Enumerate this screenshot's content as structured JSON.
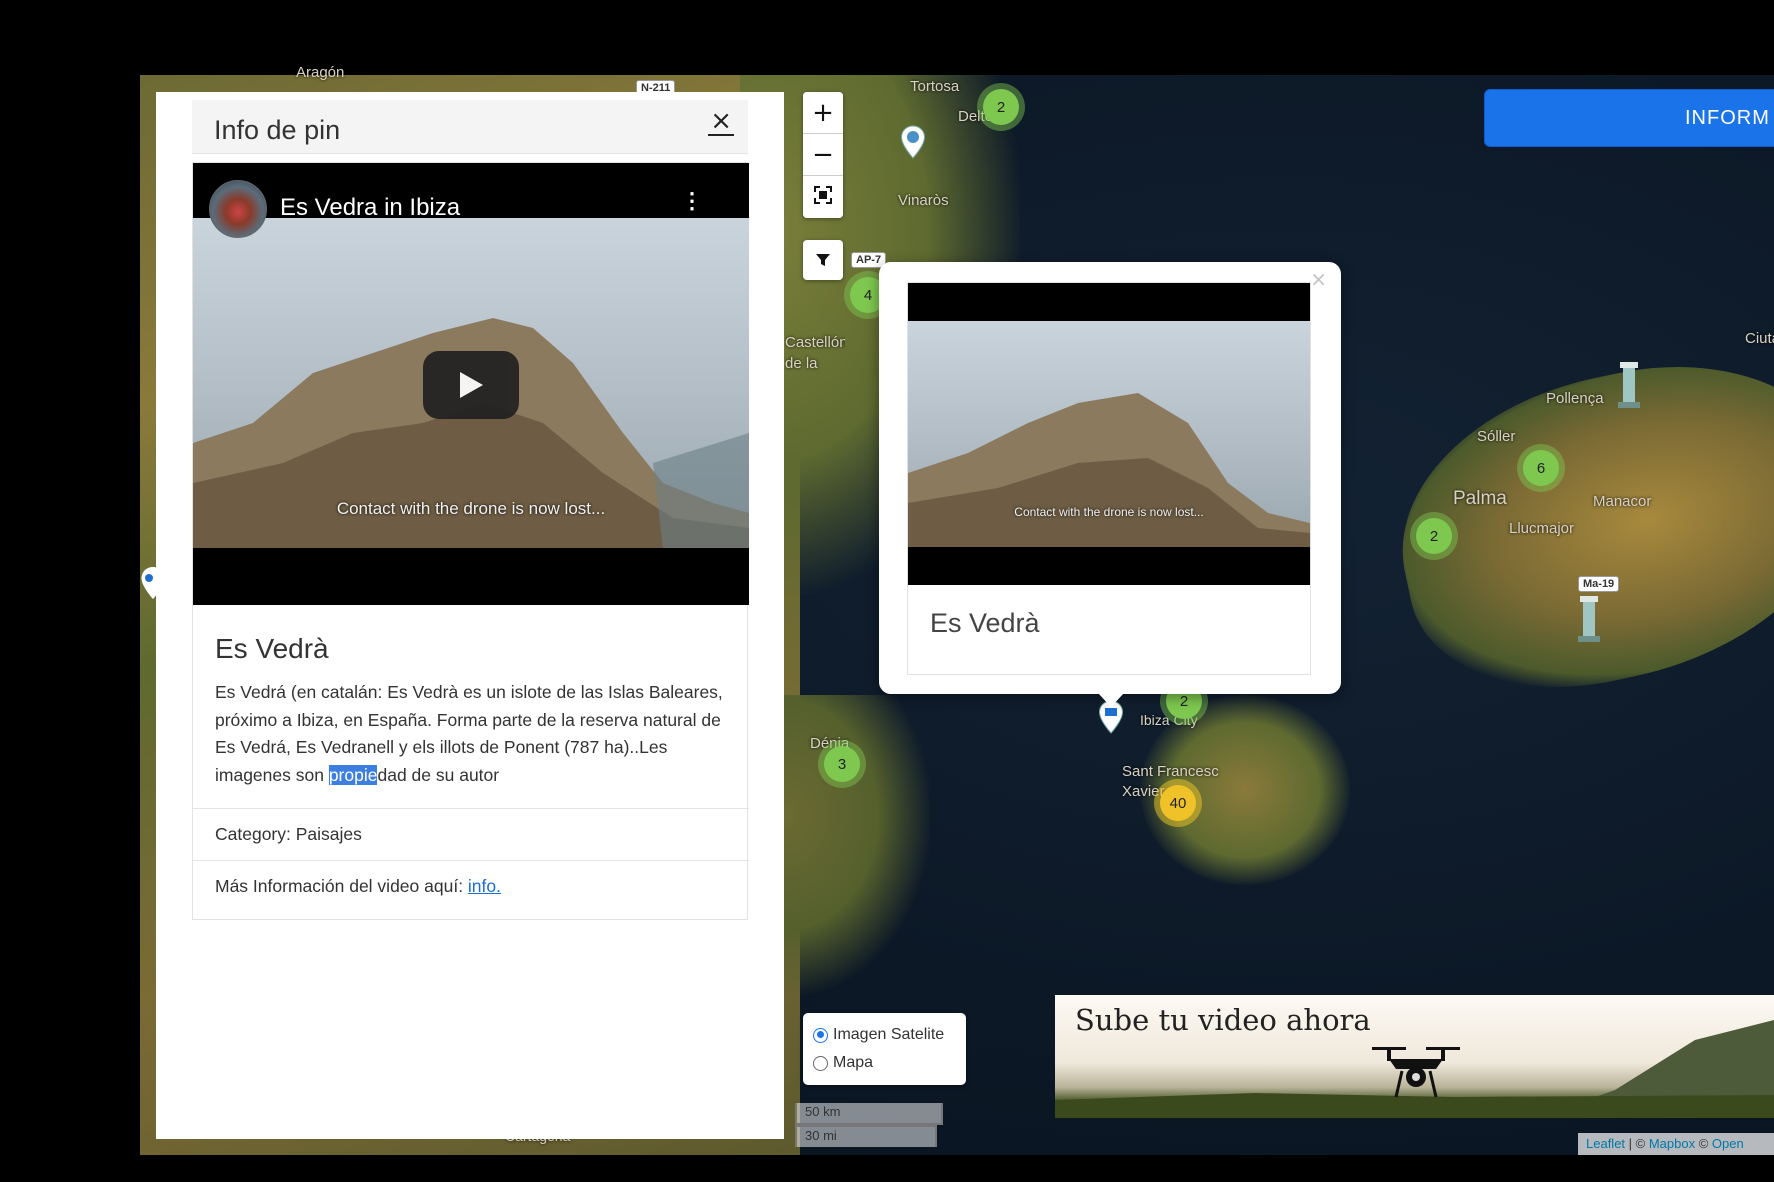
{
  "side_panel": {
    "title": "Info de pin",
    "close_label": "×",
    "video": {
      "title": "Es Vedra in Ibiza",
      "subtitle": "Contact with the drone is now lost..."
    },
    "card_title": "Es Vedrà",
    "description_before": "Es Vedrá (en catalán: Es Vedrà es un islote de las Islas Baleares, próximo a Ibiza, en España. Forma parte de la reserva natural de Es Vedrá, Es Vedranell y els illots de Ponent (787 ha)..Les imagenes son ",
    "description_selected": "propie",
    "description_after": "dad de su autor",
    "category": "Category: Paisajes",
    "more_info_label": "Más Información del video aquí: ",
    "more_info_link": "info."
  },
  "popup": {
    "close_label": "×",
    "video_subtitle": "Contact with the drone is now lost...",
    "title": "Es Vedrà"
  },
  "map": {
    "zoom_in": "+",
    "zoom_out": "−",
    "top_button_label": "INFORM",
    "road_badges": [
      "N-211",
      "AP-7",
      "Ma-19"
    ],
    "places": [
      "Aragón",
      "Tortosa",
      "Deltebre",
      "Vinaròs",
      "Castellón de la Plana",
      "Pollença",
      "Sóller",
      "Palma",
      "Manacor",
      "Llucmajor",
      "Ibiza City",
      "Dénia",
      "Sant Francesc Xavier",
      "Ciutadella de Menorca",
      "Cartagena"
    ],
    "clusters": [
      {
        "count": "2",
        "color": "green"
      },
      {
        "count": "4",
        "color": "green"
      },
      {
        "count": "6",
        "color": "green"
      },
      {
        "count": "2",
        "color": "green"
      },
      {
        "count": "2",
        "color": "green"
      },
      {
        "count": "3",
        "color": "green"
      },
      {
        "count": "40",
        "color": "yellow"
      }
    ]
  },
  "layers": {
    "option_satellite": "Imagen Satelite",
    "option_map": "Mapa",
    "selected": "Imagen Satelite"
  },
  "scale": {
    "km": "50 km",
    "mi": "30 mi"
  },
  "banner": {
    "text": "Sube tu video ahora"
  },
  "attribution": {
    "leaflet": "Leaflet",
    "mapbox": "Mapbox",
    "open": "Open"
  },
  "colors": {
    "accent": "#1a73e8",
    "cluster_green": "#7ec850",
    "cluster_yellow": "#f0c22a"
  }
}
